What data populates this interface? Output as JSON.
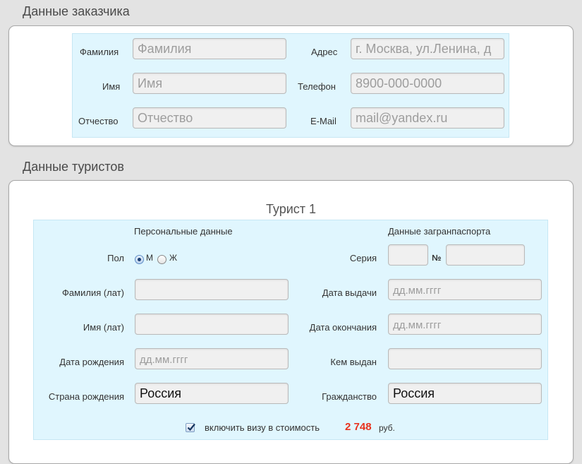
{
  "customer": {
    "title": "Данные заказчика",
    "labels": {
      "last_name": "Фамилия",
      "first_name": "Имя",
      "middle_name": "Отчество",
      "address": "Адрес",
      "phone": "Телефон",
      "email": "E-Mail"
    },
    "placeholders": {
      "last_name": "Фамилия",
      "first_name": "Имя",
      "middle_name": "Отчество",
      "address": "г. Москва, ул.Ленина, д",
      "phone": "8900-000-0000",
      "email": "mail@yandex.ru"
    }
  },
  "tourists": {
    "title": "Данные туристов",
    "tourist_title": "Турист 1",
    "personal_header": "Персональные данные",
    "passport_header": "Данные загранпаспорта",
    "labels": {
      "gender": "Пол",
      "gender_m": "М",
      "gender_f": "Ж",
      "last_name_lat": "Фамилия (лат)",
      "first_name_lat": "Имя (лат)",
      "birth_date": "Дата рождения",
      "birth_country": "Страна рождения",
      "series": "Серия",
      "number": "№",
      "issue_date": "Дата выдачи",
      "expiry_date": "Дата окончания",
      "issued_by": "Кем выдан",
      "citizenship": "Гражданство"
    },
    "values": {
      "birth_country": "Россия",
      "citizenship": "Россия"
    },
    "placeholders": {
      "birth_date": "дд.мм.гггг",
      "issue_date": "дд.мм.гггг",
      "expiry_date": "дд.мм.гггг"
    },
    "gender_selected": "М",
    "visa": {
      "checked": true,
      "label": "включить визу в стоимость",
      "price": "2 748",
      "currency": "руб."
    }
  }
}
